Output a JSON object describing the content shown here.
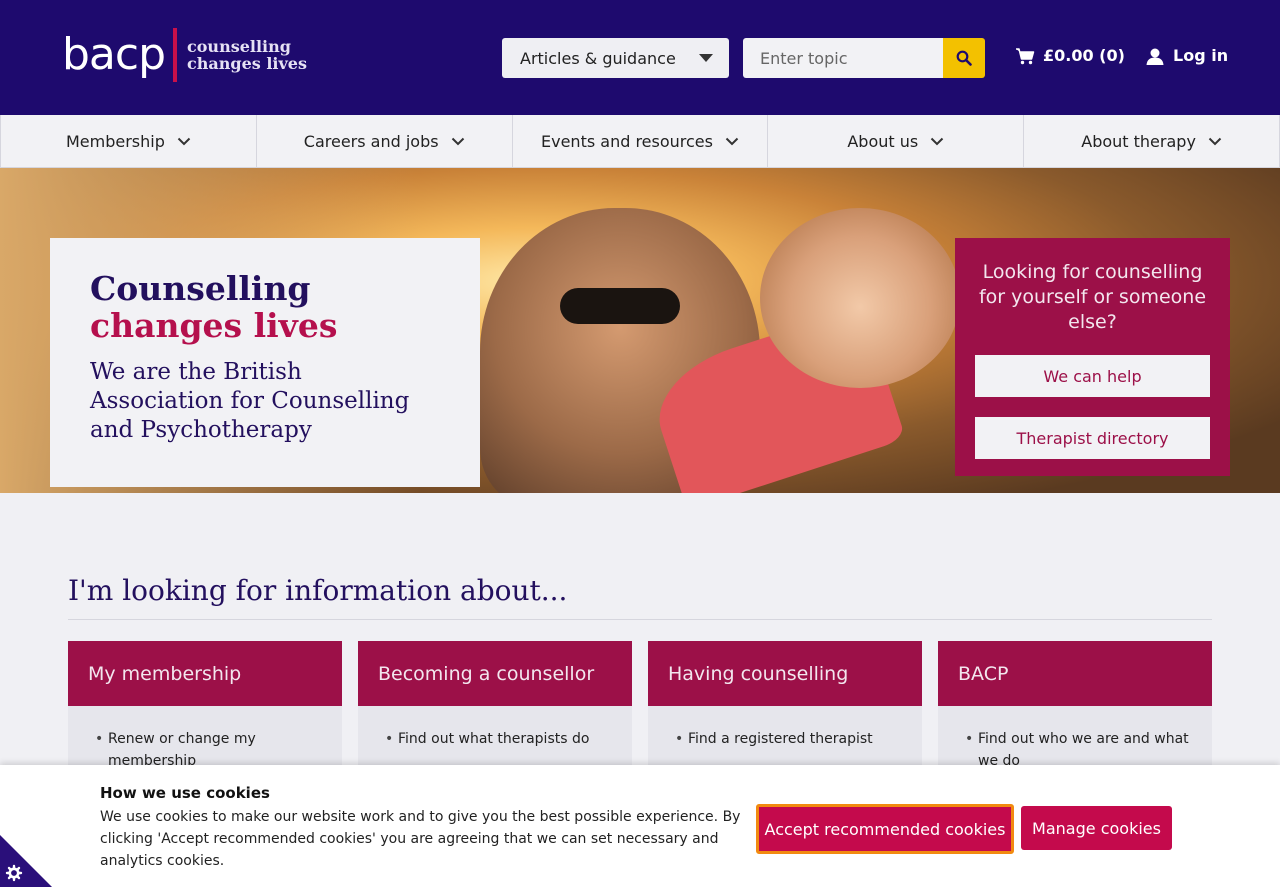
{
  "header": {
    "logo_text": "bacp",
    "tagline_line1": "counselling",
    "tagline_line2": "changes lives",
    "search_category": "Articles & guidance",
    "search_placeholder": "Enter topic",
    "basket_text": "£0.00 (0)",
    "login_label": "Log in"
  },
  "nav": {
    "items": [
      {
        "label": "Membership"
      },
      {
        "label": "Careers and jobs"
      },
      {
        "label": "Events and resources"
      },
      {
        "label": "About us"
      },
      {
        "label": "About therapy"
      }
    ]
  },
  "hero": {
    "title_part1": "Counselling",
    "title_part2": "changes lives",
    "subtitle": "We are the British Association for Counselling and Psychotherapy"
  },
  "help": {
    "question": "Looking for counselling for yourself or someone else?",
    "button1": "We can help",
    "button2": "Therapist directory"
  },
  "info": {
    "heading": "I'm looking for information about...",
    "cards": [
      {
        "title": "My membership",
        "items": [
          "Renew or change my membership"
        ]
      },
      {
        "title": "Becoming a counsellor",
        "items": [
          "Find out what therapists do"
        ]
      },
      {
        "title": "Having counselling",
        "items": [
          "Find a registered therapist"
        ]
      },
      {
        "title": "BACP",
        "items": [
          "Find out who we are and what we do"
        ]
      }
    ]
  },
  "cookies": {
    "title": "How we use cookies",
    "text": "We use cookies to make our website work and to give you the best possible experience. By clicking 'Accept recommended cookies' you are agreeing that we can set necessary and analytics cookies.",
    "accept_label": "Accept recommended cookies",
    "manage_label": "Manage cookies"
  },
  "colors": {
    "header_bg": "#1e0a6e",
    "brand_magenta": "#9c1048",
    "button_red": "#c40a4c",
    "search_yellow": "#f3c100"
  }
}
